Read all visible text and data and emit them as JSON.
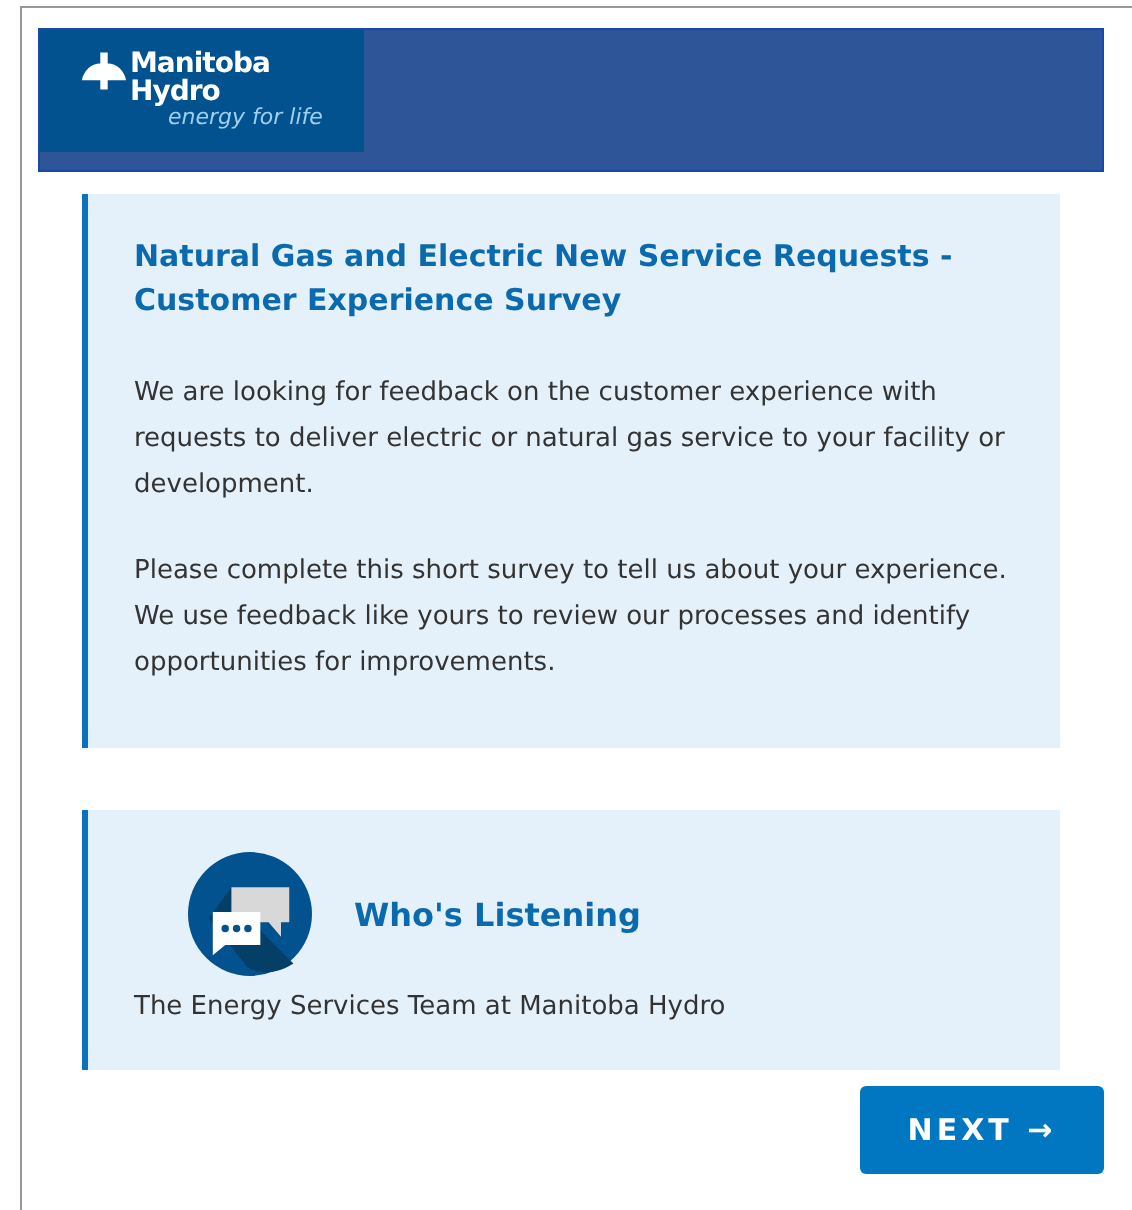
{
  "header": {
    "logo": {
      "name": "Manitoba Hydro",
      "tagline": "energy for life"
    }
  },
  "intro": {
    "title": "Natural Gas and Electric New Service Requests - Customer Experience Survey",
    "paragraphs": [
      "We are looking for feedback on the customer experience with requests to deliver electric or natural gas service to your facility or development.",
      "Please complete this short survey to tell us about your experience. We use feedback like yours to review our processes and identify opportunities for improvements."
    ]
  },
  "contact": {
    "heading": "Who's Listening",
    "text": "The Energy Services Team at Manitoba Hydro"
  },
  "next_button": "NEXT →"
}
